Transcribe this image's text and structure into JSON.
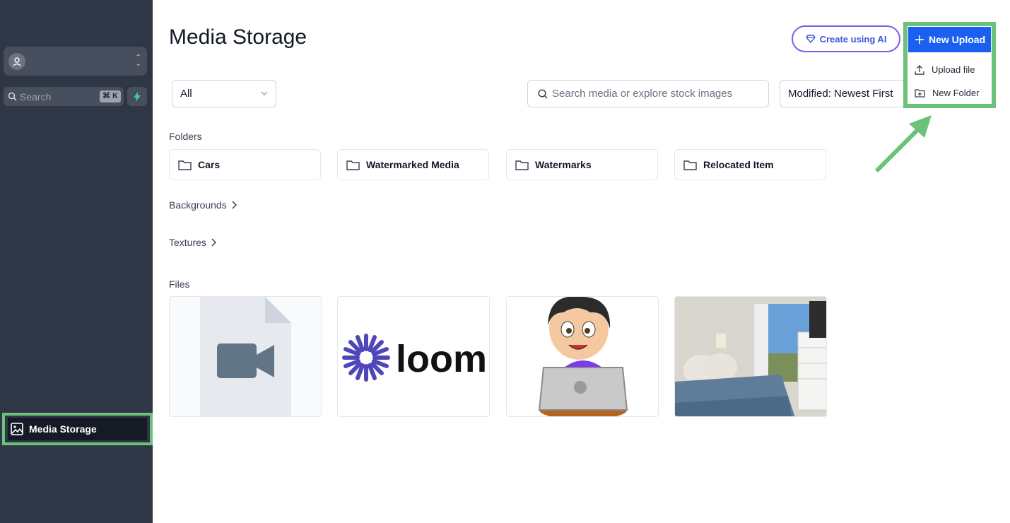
{
  "sidebar": {
    "search_placeholder": "Search",
    "search_shortcut": "⌘ K",
    "nav_media_label": "Media Storage"
  },
  "header": {
    "title": "Media Storage",
    "ai_button_label": "Create using AI",
    "new_upload_label": "New Upload",
    "menu": {
      "upload_file": "Upload file",
      "new_folder": "New Folder"
    }
  },
  "toolbar": {
    "filter_value": "All",
    "search_placeholder": "Search media or explore stock images",
    "sort_value": "Modified: Newest First"
  },
  "sections": {
    "folders": "Folders",
    "backgrounds": "Backgrounds",
    "textures": "Textures",
    "files": "Files"
  },
  "folders": [
    {
      "name": "Cars"
    },
    {
      "name": "Watermarked Media"
    },
    {
      "name": "Watermarks"
    },
    {
      "name": "Relocated Item"
    }
  ],
  "files": [
    {
      "kind": "video-icon"
    },
    {
      "logo_text": "loom"
    },
    {
      "kind": "cartoon-boy-laptop"
    },
    {
      "kind": "bedroom-photo"
    }
  ],
  "colors": {
    "sidebar_bg": "#2f3646",
    "primary": "#1a5ff0",
    "highlight": "#6cc27a",
    "ai_border": "#7c5cf0"
  }
}
